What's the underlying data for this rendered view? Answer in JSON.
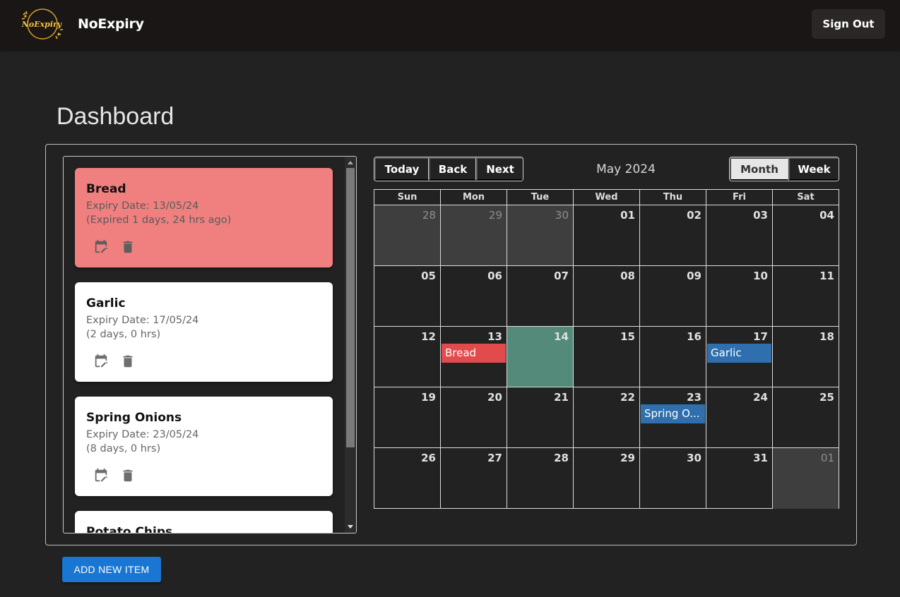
{
  "navbar": {
    "logo_text": "NoExpiry",
    "brand": "NoExpiry",
    "sign_out": "Sign Out"
  },
  "page": {
    "title": "Dashboard"
  },
  "items": [
    {
      "name": "Bread",
      "expiry_label": "Expiry Date: 13/05/24",
      "status": "(Expired 1 days, 24 hrs ago)",
      "expired": true
    },
    {
      "name": "Garlic",
      "expiry_label": "Expiry Date: 17/05/24",
      "status": "(2 days, 0 hrs)",
      "expired": false
    },
    {
      "name": "Spring Onions",
      "expiry_label": "Expiry Date: 23/05/24",
      "status": "(8 days, 0 hrs)",
      "expired": false
    },
    {
      "name": "Potato Chips",
      "expiry_label": "",
      "status": "",
      "expired": false
    }
  ],
  "list_scroll": {
    "position_fraction": 0.0,
    "visible_fraction": 0.78
  },
  "calendar": {
    "nav": {
      "today": "Today",
      "back": "Back",
      "next": "Next"
    },
    "label": "May 2024",
    "views": {
      "month": "Month",
      "week": "Week",
      "active": "month"
    },
    "weekdays": [
      "Sun",
      "Mon",
      "Tue",
      "Wed",
      "Thu",
      "Fri",
      "Sat"
    ],
    "weeks": [
      [
        {
          "d": "28",
          "off": true
        },
        {
          "d": "29",
          "off": true
        },
        {
          "d": "30",
          "off": true
        },
        {
          "d": "01"
        },
        {
          "d": "02"
        },
        {
          "d": "03"
        },
        {
          "d": "04"
        }
      ],
      [
        {
          "d": "05"
        },
        {
          "d": "06"
        },
        {
          "d": "07"
        },
        {
          "d": "08"
        },
        {
          "d": "09"
        },
        {
          "d": "10"
        },
        {
          "d": "11"
        }
      ],
      [
        {
          "d": "12"
        },
        {
          "d": "13",
          "event": {
            "title": "Bread",
            "color": "#e14b4b"
          }
        },
        {
          "d": "14",
          "today": true
        },
        {
          "d": "15"
        },
        {
          "d": "16"
        },
        {
          "d": "17",
          "event": {
            "title": "Garlic",
            "color": "#2f6fae"
          }
        },
        {
          "d": "18"
        }
      ],
      [
        {
          "d": "19"
        },
        {
          "d": "20"
        },
        {
          "d": "21"
        },
        {
          "d": "22"
        },
        {
          "d": "23",
          "event": {
            "title": "Spring O...",
            "color": "#2f6fae"
          }
        },
        {
          "d": "24"
        },
        {
          "d": "25"
        }
      ],
      [
        {
          "d": "26"
        },
        {
          "d": "27"
        },
        {
          "d": "28"
        },
        {
          "d": "29"
        },
        {
          "d": "30"
        },
        {
          "d": "31"
        },
        {
          "d": "01",
          "off": true
        }
      ]
    ]
  },
  "actions": {
    "add_new_item": "ADD NEW ITEM"
  },
  "colors": {
    "navbar_bg": "#1a1616",
    "page_bg": "#222222",
    "expired_card": "#f08080",
    "today_cell": "#548a7a",
    "expired_event": "#e14b4b",
    "upcoming_event": "#2f6fae",
    "primary_button": "#1976d2"
  },
  "icons": {
    "card_edit": "calendar-edit-icon",
    "card_delete": "trash-icon"
  }
}
